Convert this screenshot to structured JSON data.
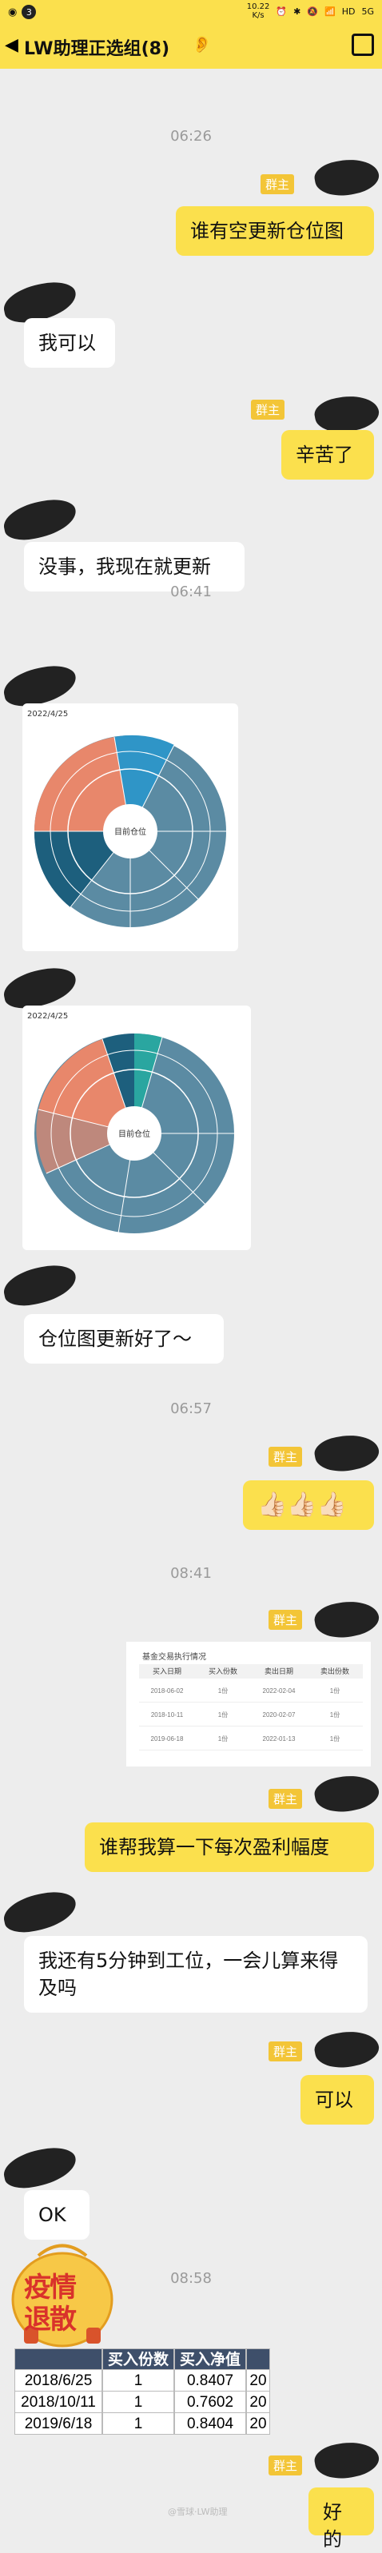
{
  "status": {
    "badge": "3",
    "speed_top": "10.22",
    "speed_bottom": "K/s",
    "net": "HD",
    "signal": "5G"
  },
  "header": {
    "title": "LW助理正选组(8)"
  },
  "admin_label": "群主",
  "times": [
    "06:26",
    "06:41",
    "06:57",
    "08:41",
    "08:58"
  ],
  "messages": {
    "m1": "谁有空更新仓位图",
    "m2": "我可以",
    "m3": "辛苦了",
    "m4": "没事，我现在就更新",
    "m5": "仓位图更新好了～",
    "m6": "👍🏻👍🏻👍🏻",
    "m7": "谁帮我算一下每次盈利幅度",
    "m8": "我还有5分钟到工位，一会儿算来得及吗",
    "m9": "可以",
    "m10": "OK",
    "m11": "好的"
  },
  "chart1": {
    "date": "2022/4/25",
    "center": "目前仓位"
  },
  "chart2": {
    "date": "2022/4/25",
    "center": "目前仓位"
  },
  "table_shot": {
    "title": "基金交易执行情况",
    "headers": [
      "买入日期",
      "买入份数",
      "卖出日期",
      "卖出份数"
    ],
    "rows": [
      [
        "2018-06-02",
        "1份",
        "2022-02-04",
        "1份"
      ],
      [
        "2018-10-11",
        "1份",
        "2020-02-07",
        "1份"
      ],
      [
        "2019-06-18",
        "1份",
        "2022-01-13",
        "1份"
      ]
    ]
  },
  "sticker": {
    "line1": "疫情",
    "line2": "退散"
  },
  "big_table": {
    "headers": [
      "",
      "买入份数",
      "买入净值",
      ""
    ],
    "rows": [
      [
        "2018/6/25",
        "1",
        "0.8407",
        "20"
      ],
      [
        "2018/10/11",
        "1",
        "0.7602",
        "20"
      ],
      [
        "2019/6/18",
        "1",
        "0.8404",
        "20"
      ]
    ]
  },
  "watermark": "@雪球·LW助理",
  "colors": {
    "header_bg": "#fbe04d",
    "my_bubble": "#fbe04d",
    "admin_badge": "#f3c537",
    "chart_main": "#5b8ba3",
    "chart_salmon": "#e8876b",
    "chart_dark": "#1d5f7d"
  }
}
